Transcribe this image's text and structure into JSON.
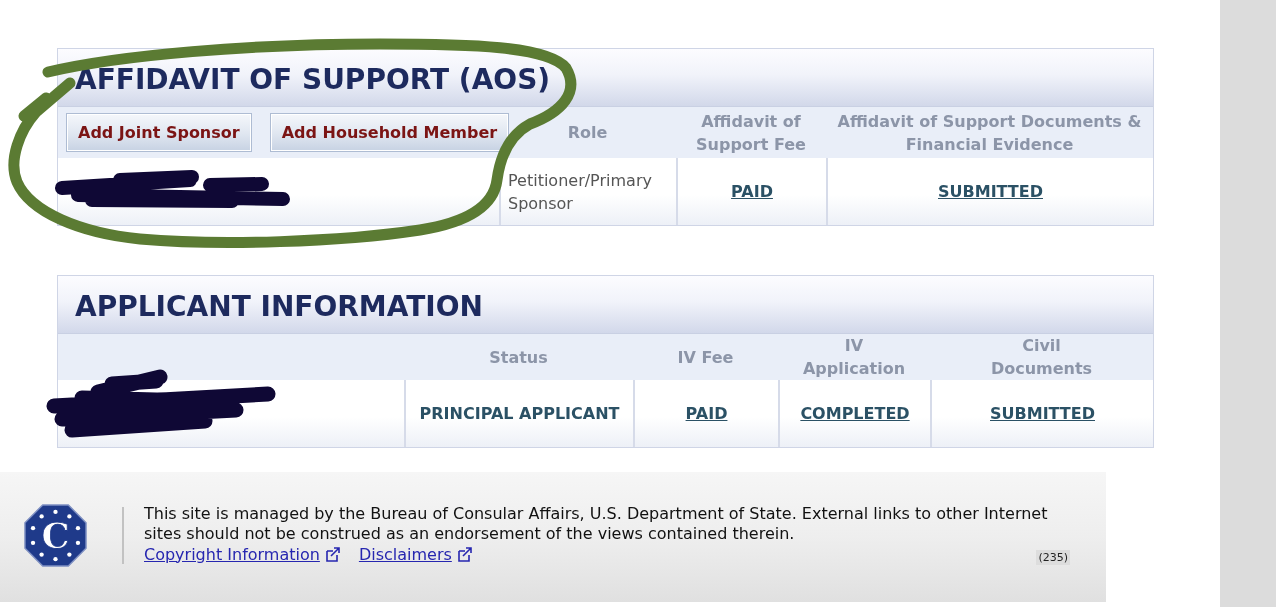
{
  "sections": [
    {
      "kind": "sponsors",
      "title": "AFFIDAVIT OF SUPPORT (AOS)",
      "buttons": [
        "Add Joint Sponsor",
        "Add Household Member"
      ],
      "columns": [
        "Role",
        "Affidavit of Support Fee",
        "Affidavit of Support Documents & Financial Evidence"
      ],
      "rows": [
        {
          "cells": [
            {
              "kind": "text",
              "text": "Petitioner/Primary Sponsor"
            },
            {
              "kind": "link",
              "text": "PAID"
            },
            {
              "kind": "link",
              "text": "SUBMITTED"
            }
          ]
        }
      ]
    },
    {
      "kind": "applicants",
      "title": "APPLICANT INFORMATION",
      "columns": [
        "Status",
        "IV Fee",
        "IV Application",
        "Civil Documents"
      ],
      "rows": [
        {
          "cells": [
            {
              "kind": "status",
              "text": "PRINCIPAL APPLICANT"
            },
            {
              "kind": "link",
              "text": "PAID"
            },
            {
              "kind": "link",
              "text": "COMPLETED"
            },
            {
              "kind": "link",
              "text": "SUBMITTED"
            }
          ]
        }
      ]
    }
  ],
  "footer": {
    "logo_letter": "C",
    "notice": "This site is managed by the Bureau of Consular Affairs, U.S. Department of State. External links to other Internet sites should not be construed as an endorsement of the views contained therein.",
    "links": [
      "Copyright Information",
      "Disclaimers"
    ],
    "page_code": "(235)"
  }
}
